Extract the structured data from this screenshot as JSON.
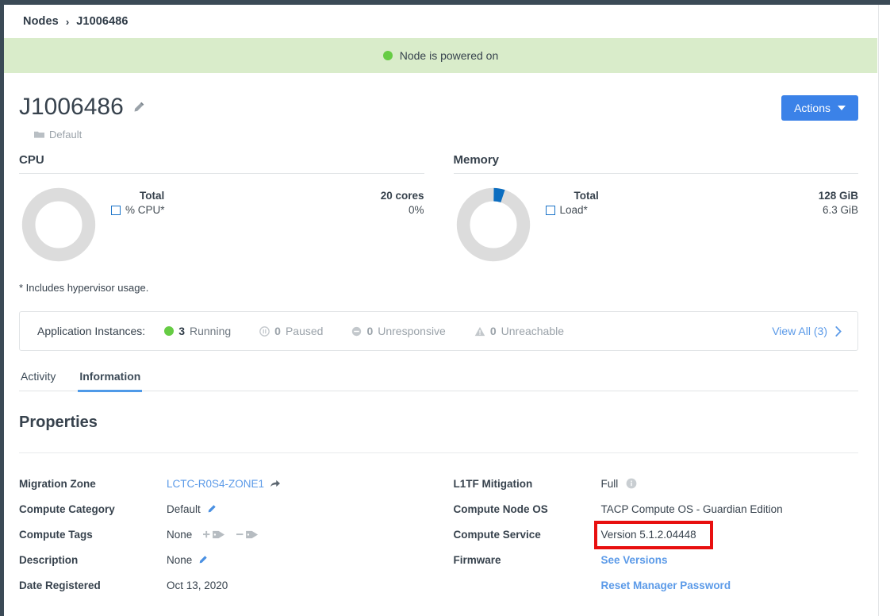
{
  "breadcrumb": {
    "root": "Nodes",
    "separator": "›",
    "current": "J1006486"
  },
  "banner": {
    "text": "Node is powered on",
    "status_color": "#66cc44"
  },
  "header": {
    "title": "J1006486",
    "edit_icon": "pencil-icon",
    "group": "Default",
    "group_icon": "folder-icon",
    "actions_label": "Actions",
    "actions_color": "#3b82e8"
  },
  "metrics": [
    {
      "title": "CPU",
      "total_label": "Total",
      "total_value": "20 cores",
      "metric_label": "% CPU*",
      "metric_value": "0%",
      "percent": 0,
      "arc_color": "#0b6dc0",
      "track_color": "#dcdcdc"
    },
    {
      "title": "Memory",
      "total_label": "Total",
      "total_value": "128 GiB",
      "metric_label": "Load*",
      "metric_value": "6.3 GiB",
      "percent": 4.9,
      "arc_color": "#0b6dc0",
      "track_color": "#dcdcdc"
    }
  ],
  "footnote": "* Includes hypervisor usage.",
  "instances": {
    "label": "Application Instances:",
    "items": [
      {
        "count": "3",
        "label": "Running",
        "icon": "green-circle-icon",
        "state": "active"
      },
      {
        "count": "0",
        "label": "Paused",
        "icon": "pause-circle-icon",
        "state": "muted"
      },
      {
        "count": "0",
        "label": "Unresponsive",
        "icon": "minus-circle-icon",
        "state": "muted"
      },
      {
        "count": "0",
        "label": "Unreachable",
        "icon": "warning-triangle-icon",
        "state": "muted"
      }
    ],
    "view_all_label": "View All (3)",
    "view_all_icon": "chevron-right-icon"
  },
  "tabs": [
    {
      "label": "Activity",
      "active": false
    },
    {
      "label": "Information",
      "active": true
    }
  ],
  "properties": {
    "section_title": "Properties",
    "left": [
      {
        "key": "Migration Zone",
        "value": "LCTC-R0S4-ZONE1",
        "value_type": "link",
        "icon": "share-arrow-icon"
      },
      {
        "key": "Compute Category",
        "value": "Default",
        "value_type": "text",
        "icon": "pencil-icon"
      },
      {
        "key": "Compute Tags",
        "value": "None",
        "value_type": "text",
        "icon": "add-tag-icon",
        "icon2": "remove-tag-icon"
      },
      {
        "key": "Description",
        "value": "None",
        "value_type": "text",
        "icon": "pencil-icon"
      },
      {
        "key": "Date Registered",
        "value": "Oct 13, 2020",
        "value_type": "text"
      }
    ],
    "right": [
      {
        "key": "L1TF Mitigation",
        "value": "Full",
        "value_type": "text",
        "icon": "info-icon"
      },
      {
        "key": "Compute Node OS",
        "value": "TACP Compute OS - Guardian Edition",
        "value_type": "text"
      },
      {
        "key": "Compute Service",
        "value": "Version 5.1.2.04448",
        "value_type": "text",
        "highlighted": true
      },
      {
        "key": "Firmware",
        "value": "See Versions",
        "value_type": "link-bold"
      },
      {
        "key": "",
        "value": "Reset Manager Password",
        "value_type": "link-bold"
      }
    ]
  },
  "annotation": {
    "highlight_color": "#e81010",
    "target": "Version 5.1.2.04448"
  }
}
